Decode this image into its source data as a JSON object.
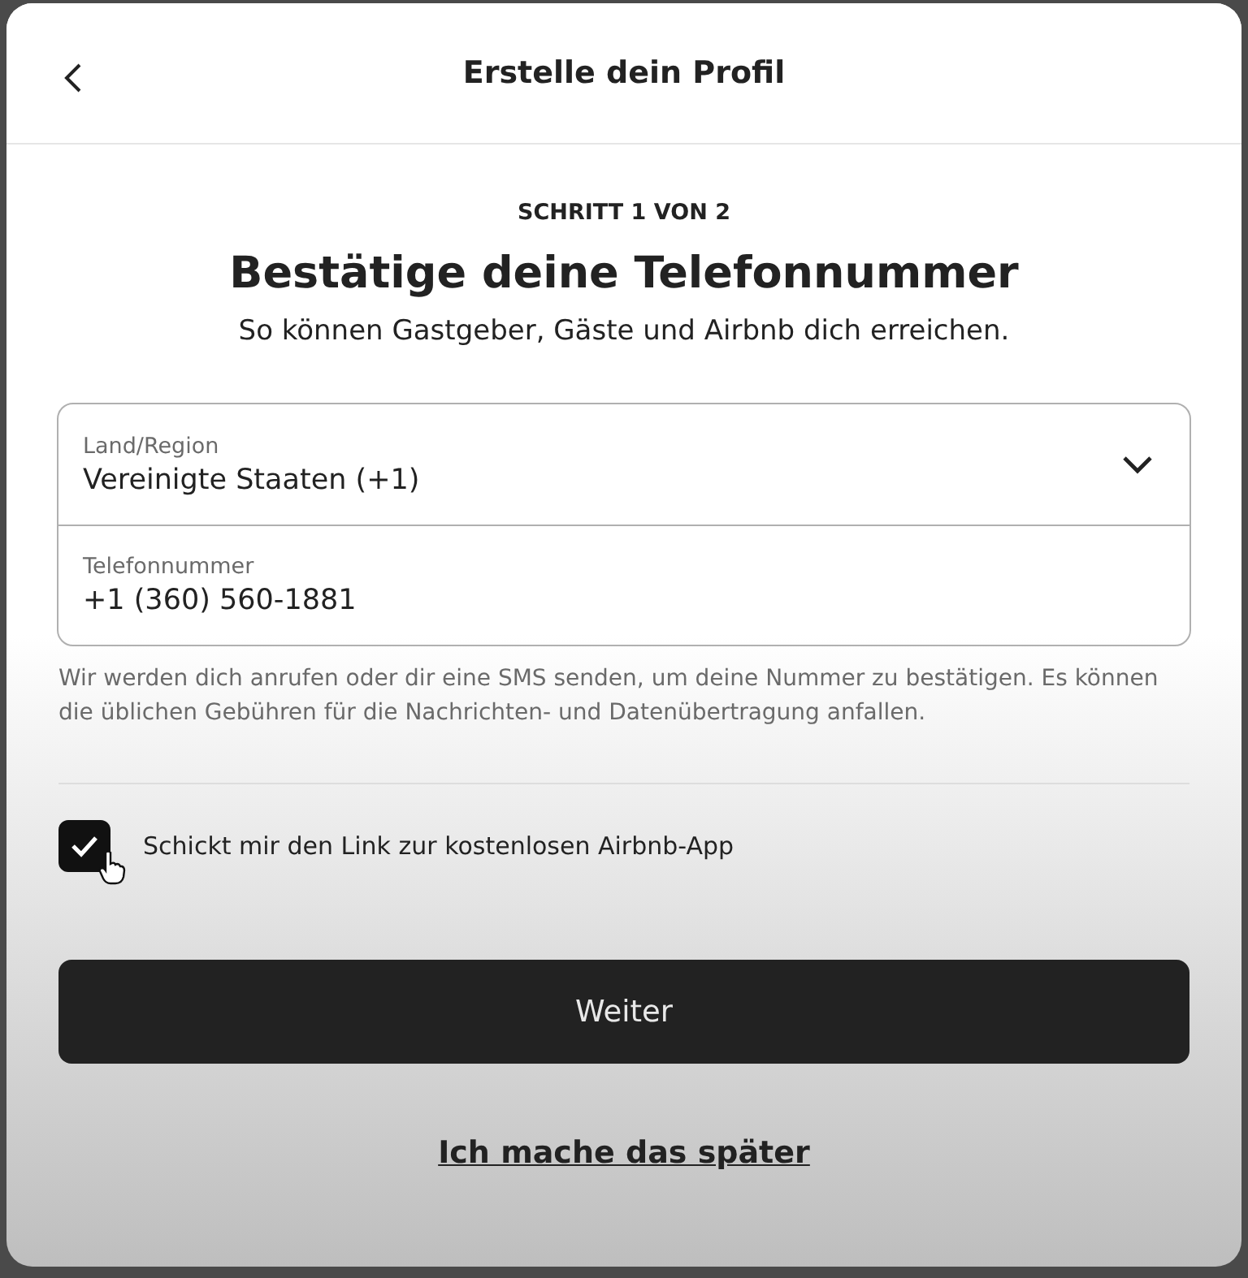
{
  "header": {
    "title": "Erstelle dein Profil"
  },
  "step": "SCHRITT 1 VON 2",
  "heading": "Bestätige deine Telefonnummer",
  "subheading": "So können Gastgeber, Gäste und Airbnb dich erreichen.",
  "fields": [
    {
      "kind": "select",
      "label": "Land/Region",
      "value": "Vereinigte Staaten (+1)"
    },
    {
      "kind": "text",
      "label": "Telefonnummer",
      "value": "+1 (360) 560-1881"
    }
  ],
  "notice": "Wir werden dich anrufen oder dir eine SMS senden, um deine Nummer zu bestätigen. Es können die üblichen Gebühren für die Nachrichten- und Datenübertragung anfallen.",
  "app_link_option": {
    "label": "Schickt mir den Link zur kostenlosen Airbnb-App",
    "checked": true
  },
  "continue_button": "Weiter",
  "later_link": "Ich mache das später"
}
